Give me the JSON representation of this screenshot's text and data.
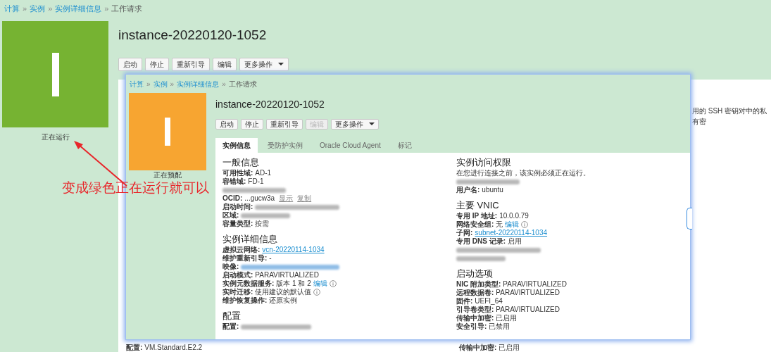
{
  "breadcrumb": {
    "separator": "»",
    "items": [
      {
        "label": "计算",
        "link": true
      },
      {
        "label": "实例",
        "link": true
      },
      {
        "label": "实例详细信息",
        "link": true
      },
      {
        "label": "工作请求",
        "link": false
      }
    ]
  },
  "status_tile": {
    "color": "#76b332",
    "label": "正在运行"
  },
  "title": "instance-20220120-1052",
  "buttons": [
    {
      "label": "启动",
      "disabled": false,
      "dropdown": false
    },
    {
      "label": "停止",
      "disabled": false,
      "dropdown": false
    },
    {
      "label": "重新引导",
      "disabled": false,
      "dropdown": false
    },
    {
      "label": "编辑",
      "disabled": false,
      "dropdown": false
    },
    {
      "label": "更多操作",
      "disabled": false,
      "dropdown": true
    }
  ],
  "partial_text": "用的 SSH 密钥对中的私有密",
  "bottom_fields": [
    {
      "label": "配置:",
      "value": "VM.Standard.E2.2"
    },
    {
      "label": "传输中加密:",
      "value": "已启用"
    }
  ],
  "screenshot": {
    "breadcrumb": {
      "separator": "»",
      "items": [
        {
          "label": "计算",
          "link": true
        },
        {
          "label": "实例",
          "link": true
        },
        {
          "label": "实例详细信息",
          "link": true
        },
        {
          "label": "工作请求",
          "link": false
        }
      ]
    },
    "status_tile": {
      "color": "#f7a531",
      "label": "正在预配"
    },
    "title": "instance-20220120-1052",
    "buttons": [
      {
        "label": "启动",
        "disabled": false,
        "dropdown": false
      },
      {
        "label": "停止",
        "disabled": false,
        "dropdown": false
      },
      {
        "label": "重新引导",
        "disabled": false,
        "dropdown": false
      },
      {
        "label": "编辑",
        "disabled": true,
        "dropdown": false
      },
      {
        "label": "更多操作",
        "disabled": false,
        "dropdown": true
      }
    ],
    "tabs": [
      {
        "label": "实例信息",
        "selected": true
      },
      {
        "label": "受防护实例",
        "selected": false
      },
      {
        "label": "Oracle Cloud Agent",
        "selected": false
      },
      {
        "label": "标记",
        "selected": false
      }
    ],
    "columns": [
      [
        {
          "heading": "一般信息",
          "rows": [
            {
              "kind": "field",
              "label": "可用性域:",
              "value": "AD-1"
            },
            {
              "kind": "field",
              "label": "容错域:",
              "value": "FD-1"
            },
            {
              "kind": "blurred"
            },
            {
              "kind": "field",
              "label": "OCID:",
              "value": "...gucw3a",
              "actions": [
                "显示",
                "复制"
              ]
            },
            {
              "kind": "masked",
              "label": "启动时间:"
            },
            {
              "kind": "masked",
              "label": "区域:"
            },
            {
              "kind": "field",
              "label": "容量类型:",
              "value": "按需"
            }
          ]
        },
        {
          "heading": "实例详细信息",
          "rows": [
            {
              "kind": "link",
              "label": "虚拟云网络:",
              "value": "vcn-20220114-1034"
            },
            {
              "kind": "field",
              "label": "维护重新引导:",
              "value": "-"
            },
            {
              "kind": "masked-link",
              "label": "映像:"
            },
            {
              "kind": "field",
              "label": "启动模式:",
              "value": "PARAVIRTUALIZED"
            },
            {
              "kind": "field",
              "label": "实例元数据服务:",
              "value": "版本 1 和 2",
              "edit": "编辑",
              "info": true
            },
            {
              "kind": "field",
              "label": "实时迁移:",
              "value": "使用建议的默认值",
              "info": true
            },
            {
              "kind": "field",
              "label": "维护恢复操作:",
              "value": "还原实例"
            }
          ]
        },
        {
          "heading": "配置",
          "rows": [
            {
              "kind": "masked",
              "label": "配置:"
            }
          ]
        }
      ],
      [
        {
          "heading": "实例访问权限",
          "rows": [
            {
              "kind": "note",
              "text": "在您进行连接之前，该实例必须正在运行。"
            },
            {
              "kind": "blurred"
            },
            {
              "kind": "field",
              "label": "用户名:",
              "value": "ubuntu"
            }
          ]
        },
        {
          "heading": "主要 VNIC",
          "rows": [
            {
              "kind": "field",
              "label": "专用 IP 地址:",
              "value": "10.0.0.79"
            },
            {
              "kind": "field",
              "label": "网络安全组:",
              "value": "无",
              "edit": "编辑",
              "info": true
            },
            {
              "kind": "link",
              "label": "子网:",
              "value": "subnet-20220114-1034"
            },
            {
              "kind": "field",
              "label": "专用 DNS 记录:",
              "value": "启用"
            },
            {
              "kind": "blurred"
            },
            {
              "kind": "blurred"
            }
          ]
        },
        {
          "heading": "启动选项",
          "rows": [
            {
              "kind": "field",
              "label": "NIC 附加类型:",
              "value": "PARAVIRTUALIZED"
            },
            {
              "kind": "field",
              "label": "远程数据卷:",
              "value": "PARAVIRTUALIZED"
            },
            {
              "kind": "field",
              "label": "固件:",
              "value": "UEFI_64"
            },
            {
              "kind": "field",
              "label": "引导卷类型:",
              "value": "PARAVIRTUALIZED"
            },
            {
              "kind": "field",
              "label": "传输中加密:",
              "value": "已启用"
            },
            {
              "kind": "field",
              "label": "安全引导:",
              "value": "已禁用"
            }
          ]
        }
      ]
    ]
  },
  "annotation": {
    "text": "变成绿色正在运行就可以"
  }
}
